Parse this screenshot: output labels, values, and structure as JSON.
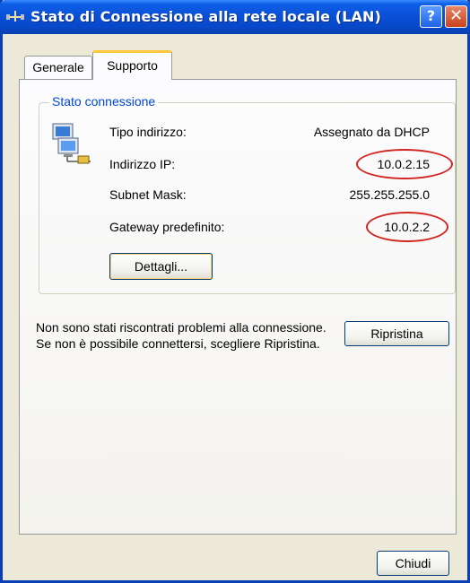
{
  "window": {
    "title": "Stato di Connessione alla rete locale (LAN)",
    "help_glyph": "?",
    "close_glyph": "✕"
  },
  "tabs": [
    {
      "label": "Generale",
      "active": false
    },
    {
      "label": "Supporto",
      "active": true
    }
  ],
  "status_group": {
    "title": "Stato connessione",
    "rows": [
      {
        "label": "Tipo indirizzo:",
        "value": "Assegnato da DHCP"
      },
      {
        "label": "Indirizzo IP:",
        "value": "10.0.2.15"
      },
      {
        "label": "Subnet Mask:",
        "value": "255.255.255.0"
      },
      {
        "label": "Gateway predefinito:",
        "value": "10.0.2.2"
      }
    ],
    "details_button": "Dettagli..."
  },
  "repair": {
    "message": "Non sono stati riscontrati problemi alla connessione. Se non è possibile connettersi, scegliere Ripristina.",
    "button": "Ripristina"
  },
  "footer": {
    "close_button": "Chiudi"
  },
  "colors": {
    "annotation_circle": "#d0261f",
    "title_bar": "#0a50d8",
    "group_title": "#0046d5"
  }
}
